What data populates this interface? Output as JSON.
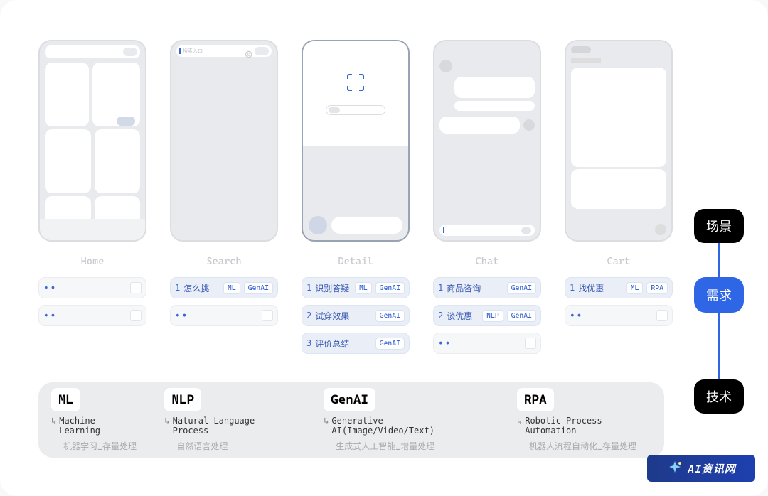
{
  "scenes": {
    "home": {
      "title": "Home"
    },
    "search": {
      "title": "Search",
      "placeholder": "搜索入口"
    },
    "detail": {
      "title": "Detail"
    },
    "chat": {
      "title": "Chat"
    },
    "cart": {
      "title": "Cart"
    }
  },
  "requirements": {
    "home": [
      {
        "dots": "••"
      },
      {
        "dots": "••"
      }
    ],
    "detail": [
      {
        "num": "1",
        "label": "识别答疑",
        "tags": [
          "ML",
          "GenAI"
        ]
      },
      {
        "num": "2",
        "label": "试穿效果",
        "tags": [
          "GenAI"
        ]
      },
      {
        "num": "3",
        "label": "评价总结",
        "tags": [
          "GenAI"
        ]
      }
    ],
    "search": [
      {
        "num": "1",
        "label": "怎么挑",
        "tags": [
          "ML",
          "GenAI"
        ]
      },
      {
        "dots": "••"
      }
    ],
    "chat": [
      {
        "num": "1",
        "label": "商品咨询",
        "tags": [
          "GenAI"
        ]
      },
      {
        "num": "2",
        "label": "谈优惠",
        "tags": [
          "NLP",
          "GenAI"
        ]
      },
      {
        "dots": "••"
      }
    ],
    "cart": [
      {
        "num": "1",
        "label": "找优惠",
        "tags": [
          "ML",
          "RPA"
        ]
      },
      {
        "dots": "••"
      }
    ]
  },
  "rightnav": {
    "scene": "场景",
    "req": "需求",
    "tech": "技术"
  },
  "tech": {
    "ml": {
      "badge": "ML",
      "full": "Machine Learning",
      "desc": "机器学习_存量处理"
    },
    "nlp": {
      "badge": "NLP",
      "full": "Natural Language Process",
      "desc": "自然语言处理"
    },
    "genai": {
      "badge": "GenAI",
      "full": "Generative AI(Image/Video/Text)",
      "desc": "生成式人工智能_增量处理"
    },
    "rpa": {
      "badge": "RPA",
      "full": "Robotic Process Automation",
      "desc": "机器人流程自动化_存量处理"
    }
  },
  "arrow": "↳",
  "watermark": "AI资讯网"
}
